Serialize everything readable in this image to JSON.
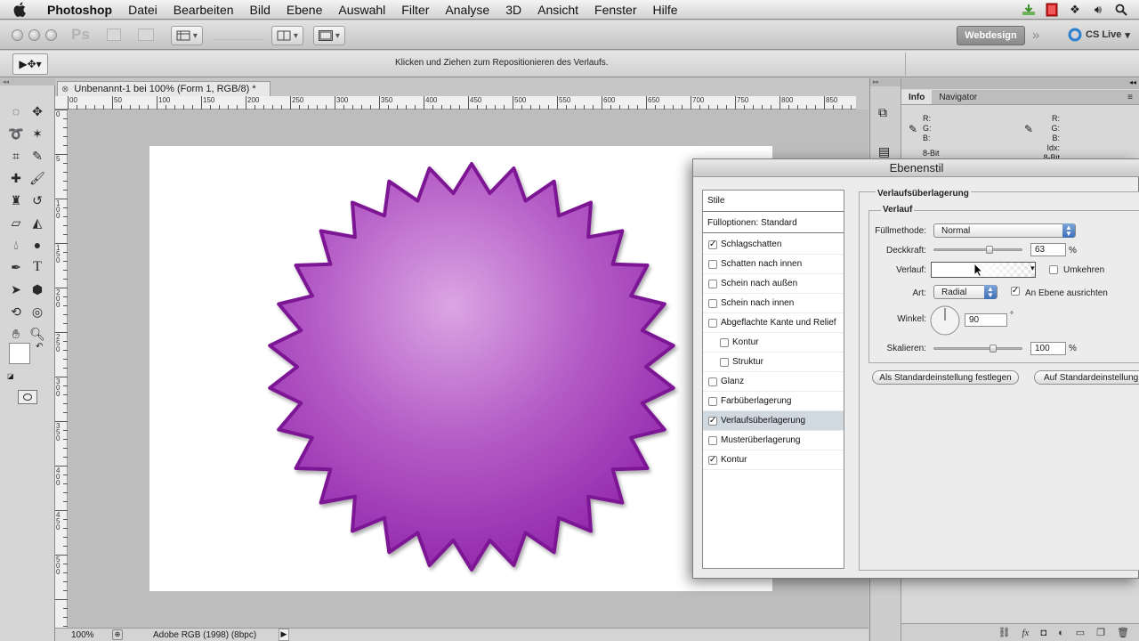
{
  "menubar": {
    "app": "Photoshop",
    "items": [
      "Datei",
      "Bearbeiten",
      "Bild",
      "Ebene",
      "Auswahl",
      "Filter",
      "Analyse",
      "3D",
      "Ansicht",
      "Fenster",
      "Hilfe"
    ]
  },
  "appbar": {
    "ps_logo": "Ps",
    "workspace": "Webdesign",
    "cslive": "CS Live"
  },
  "options": {
    "hint": "Klicken und Ziehen zum Repositionieren des Verlaufs."
  },
  "document": {
    "tab_title": "Unbenannt-1 bei 100% (Form 1, RGB/8) *",
    "ruler_top": [
      "00",
      "50",
      "100",
      "150",
      "200",
      "250",
      "300",
      "350",
      "400",
      "450",
      "500",
      "550",
      "600",
      "650",
      "700",
      "750",
      "800",
      "850"
    ],
    "ruler_left": [
      "0",
      "5",
      "1 0 0",
      "1 5 0",
      "2 0 0",
      "2 5 0",
      "3 0 0",
      "3 5 0",
      "4 0 0",
      "4 5 0",
      "5 0 0"
    ],
    "shape_gradient": {
      "center": "#dba5e3",
      "mid": "#b45cc6",
      "edge": "#8a1aa5",
      "stroke": "#7c1494"
    }
  },
  "status": {
    "zoom": "100%",
    "profile": "Adobe RGB (1998) (8bpc)"
  },
  "panel": {
    "tabs": [
      "Info",
      "Navigator"
    ],
    "left": [
      "R:",
      "G:",
      "B:",
      "8-Bit"
    ],
    "right": [
      "R:",
      "G:",
      "B:",
      "Idx:",
      "8-Bit"
    ]
  },
  "dialog": {
    "title": "Ebenenstil",
    "styles_header": "Stile",
    "fill_options": "Fülloptionen: Standard",
    "styles": [
      {
        "label": "Schlagschatten",
        "checked": true
      },
      {
        "label": "Schatten nach innen",
        "checked": false
      },
      {
        "label": "Schein nach außen",
        "checked": false
      },
      {
        "label": "Schein nach innen",
        "checked": false
      },
      {
        "label": "Abgeflachte Kante und Relief",
        "checked": false
      },
      {
        "label": "Kontur",
        "checked": false,
        "indent": true
      },
      {
        "label": "Struktur",
        "checked": false,
        "indent": true
      },
      {
        "label": "Glanz",
        "checked": false
      },
      {
        "label": "Farbüberlagerung",
        "checked": false
      },
      {
        "label": "Verlaufsüberlagerung",
        "checked": true,
        "selected": true
      },
      {
        "label": "Musterüberlagerung",
        "checked": false
      },
      {
        "label": "Kontur",
        "checked": true
      }
    ],
    "section_title": "Verlaufsüberlagerung",
    "subsection_title": "Verlauf",
    "blend_label": "Füllmethode:",
    "blend_value": "Normal",
    "opacity_label": "Deckkraft:",
    "opacity_value": "63",
    "opacity_unit": "%",
    "opacity_level": 0.63,
    "gradient_label": "Verlauf:",
    "reverse_label": "Umkehren",
    "reverse_checked": false,
    "style_label": "Art:",
    "style_value": "Radial",
    "align_label": "An Ebene ausrichten",
    "align_checked": true,
    "angle_label": "Winkel:",
    "angle_value": "90",
    "angle_unit": "°",
    "scale_label": "Skalieren:",
    "scale_value": "100",
    "scale_unit": "%",
    "scale_level": 0.67,
    "btn_set_default": "Als Standardeinstellung festlegen",
    "btn_reset_default": "Auf Standardeinstellung zurücksetzen"
  }
}
